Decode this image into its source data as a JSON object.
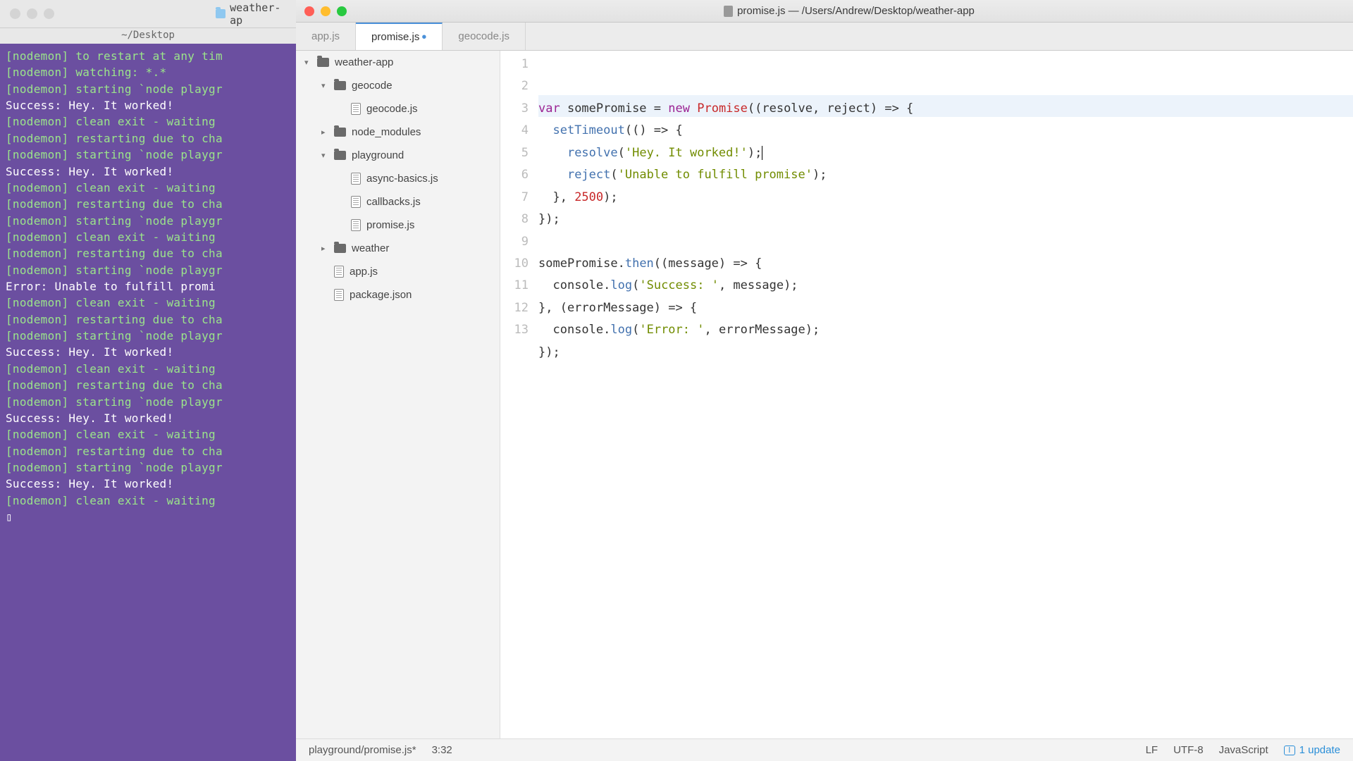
{
  "terminal": {
    "tab_title": "weather-ap",
    "path": "~/Desktop",
    "lines": [
      {
        "cls": "term-green",
        "text": "[nodemon] to restart at any tim"
      },
      {
        "cls": "term-green",
        "text": "[nodemon] watching: *.*"
      },
      {
        "cls": "term-green",
        "text": "[nodemon] starting `node playgr"
      },
      {
        "cls": "term-white",
        "text": "Success:  Hey. It worked!"
      },
      {
        "cls": "term-green",
        "text": "[nodemon] clean exit - waiting "
      },
      {
        "cls": "term-green",
        "text": "[nodemon] restarting due to cha"
      },
      {
        "cls": "term-green",
        "text": "[nodemon] starting `node playgr"
      },
      {
        "cls": "term-white",
        "text": "Success:  Hey. It worked!"
      },
      {
        "cls": "term-green",
        "text": "[nodemon] clean exit - waiting "
      },
      {
        "cls": "term-green",
        "text": "[nodemon] restarting due to cha"
      },
      {
        "cls": "term-green",
        "text": "[nodemon] starting `node playgr"
      },
      {
        "cls": "term-green",
        "text": "[nodemon] clean exit - waiting "
      },
      {
        "cls": "term-green",
        "text": "[nodemon] restarting due to cha"
      },
      {
        "cls": "term-green",
        "text": "[nodemon] starting `node playgr"
      },
      {
        "cls": "term-white",
        "text": "Error:  Unable to fulfill promi"
      },
      {
        "cls": "term-green",
        "text": "[nodemon] clean exit - waiting "
      },
      {
        "cls": "term-green",
        "text": "[nodemon] restarting due to cha"
      },
      {
        "cls": "term-green",
        "text": "[nodemon] starting `node playgr"
      },
      {
        "cls": "term-white",
        "text": "Success:  Hey. It worked!"
      },
      {
        "cls": "term-green",
        "text": "[nodemon] clean exit - waiting "
      },
      {
        "cls": "term-green",
        "text": "[nodemon] restarting due to cha"
      },
      {
        "cls": "term-green",
        "text": "[nodemon] starting `node playgr"
      },
      {
        "cls": "term-white",
        "text": "Success:  Hey. It worked!"
      },
      {
        "cls": "term-green",
        "text": "[nodemon] clean exit - waiting "
      },
      {
        "cls": "term-green",
        "text": "[nodemon] restarting due to cha"
      },
      {
        "cls": "term-green",
        "text": "[nodemon] starting `node playgr"
      },
      {
        "cls": "term-white",
        "text": "Success:  Hey. It worked!"
      },
      {
        "cls": "term-green",
        "text": "[nodemon] clean exit - waiting "
      },
      {
        "cls": "term-white",
        "text": "▯"
      }
    ]
  },
  "editor": {
    "window_title": "promise.js — /Users/Andrew/Desktop/weather-app",
    "tabs": [
      {
        "label": "app.js",
        "active": false,
        "modified": false
      },
      {
        "label": "promise.js",
        "active": true,
        "modified": true
      },
      {
        "label": "geocode.js",
        "active": false,
        "modified": false
      }
    ],
    "tree": {
      "root": "weather-app",
      "items": [
        {
          "type": "folder",
          "name": "geocode",
          "indent": 1,
          "open": true,
          "chev": "▾"
        },
        {
          "type": "file",
          "name": "geocode.js",
          "indent": 2
        },
        {
          "type": "folder",
          "name": "node_modules",
          "indent": 1,
          "open": false,
          "chev": "▸"
        },
        {
          "type": "folder",
          "name": "playground",
          "indent": 1,
          "open": true,
          "chev": "▾"
        },
        {
          "type": "file",
          "name": "async-basics.js",
          "indent": 2
        },
        {
          "type": "file",
          "name": "callbacks.js",
          "indent": 2
        },
        {
          "type": "file",
          "name": "promise.js",
          "indent": 2
        },
        {
          "type": "folder",
          "name": "weather",
          "indent": 1,
          "open": false,
          "chev": "▸"
        },
        {
          "type": "file",
          "name": "app.js",
          "indent": 1
        },
        {
          "type": "file",
          "name": "package.json",
          "indent": 1
        }
      ]
    },
    "line_numbers": [
      "1",
      "2",
      "3",
      "4",
      "5",
      "6",
      "7",
      "8",
      "9",
      "10",
      "11",
      "12",
      "13"
    ],
    "statusbar": {
      "path": "playground/promise.js*",
      "cursor": "3:32",
      "eol": "LF",
      "encoding": "UTF-8",
      "lang": "JavaScript",
      "update": "1 update"
    },
    "code_tokens": {
      "l1": {
        "var": "var",
        "sp": "somePromise",
        "eq": " = ",
        "new": "new",
        "prom": "Promise",
        "rest": "((resolve, reject) => {"
      },
      "l2": {
        "fn": "setTimeout",
        "rest": "(() => {"
      },
      "l3": {
        "fn": "resolve",
        "p": "(",
        "str": "'Hey. It worked!'",
        "rest": ");"
      },
      "l4": {
        "fn": "reject",
        "p": "(",
        "str": "'Unable to fulfill promise'",
        "rest": ");"
      },
      "l5": {
        "a": "  }, ",
        "num": "2500",
        "b": ");"
      },
      "l6": "});",
      "l8": {
        "obj": "somePromise",
        "dot": ".",
        "fn": "then",
        "rest": "((message) => {"
      },
      "l9": {
        "a": "  ",
        "obj": "console",
        "dot": ".",
        "fn": "log",
        "p": "(",
        "str": "'Success: '",
        "rest": ", message);"
      },
      "l10": "}, (errorMessage) => {",
      "l11": {
        "a": "  ",
        "obj": "console",
        "dot": ".",
        "fn": "log",
        "p": "(",
        "str": "'Error: '",
        "rest": ", errorMessage);"
      },
      "l12": "});"
    }
  }
}
